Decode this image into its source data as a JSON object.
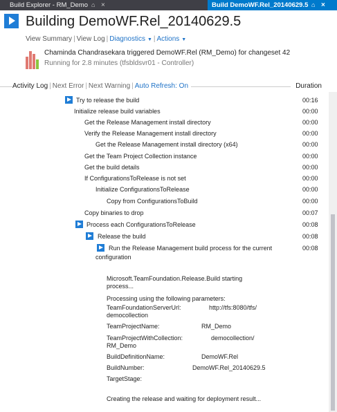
{
  "tabs": [
    {
      "label": "Build Explorer - RM_Demo",
      "pin": "⌂",
      "close": "×"
    },
    {
      "label": "Build DemoWF.Rel_20140629.5",
      "pin": "⌂",
      "close": "×"
    }
  ],
  "header": {
    "title": "Building DemoWF.Rel_20140629.5",
    "view_summary": "View Summary",
    "view_log": "View Log",
    "diagnostics": "Diagnostics",
    "actions": "Actions",
    "trigger_text": "Chaminda Chandrasekara triggered DemoWF.Rel (RM_Demo) for changeset 42",
    "running_text": "Running for 2.8 minutes (tfsbldsvr01 - Controller)",
    "bar_colors": [
      "#e07a72",
      "#e07a72",
      "#e07a72",
      "#8cc63e"
    ],
    "bar_levels": [
      0.7,
      1.0,
      0.85,
      0.55
    ]
  },
  "logbar": {
    "activity_log": "Activity Log",
    "next_error": "Next Error",
    "next_warning": "Next Warning",
    "auto_refresh": "Auto Refresh: On",
    "duration": "Duration"
  },
  "log": [
    {
      "label": "Try to release the build",
      "dur": "00:16",
      "expand": true,
      "level": 0
    },
    {
      "label": "Initialize release build variables",
      "dur": "00:00",
      "expand": false,
      "level": 1
    },
    {
      "label": "Get the Release Management install directory",
      "dur": "00:00",
      "expand": false,
      "level": 2
    },
    {
      "label": "Verify the Release Management install directory",
      "dur": "00:00",
      "expand": false,
      "level": 2
    },
    {
      "label": "Get the Release Management install directory (x64)",
      "dur": "00:00",
      "expand": false,
      "level": 3
    },
    {
      "label": "Get the Team Project Collection instance",
      "dur": "00:00",
      "expand": false,
      "level": 2
    },
    {
      "label": "Get the build details",
      "dur": "00:00",
      "expand": false,
      "level": 2
    },
    {
      "label": "If ConfigurationsToRelease is not set",
      "dur": "00:00",
      "expand": false,
      "level": 2
    },
    {
      "label": "Initialize ConfigurationsToRelease",
      "dur": "00:00",
      "expand": false,
      "level": 3
    },
    {
      "label": "Copy from ConfigurationsToBuild",
      "dur": "00:00",
      "expand": false,
      "level": 4
    },
    {
      "label": "Copy binaries to drop",
      "dur": "00:07",
      "expand": false,
      "level": 2
    },
    {
      "label": "Process each ConfigurationsToRelease",
      "dur": "00:08",
      "expand": true,
      "level": 2
    },
    {
      "label": "Release the build",
      "dur": "00:08",
      "expand": true,
      "level": 3
    },
    {
      "label": "Run the Release Management build process for the current",
      "dur": "00:08",
      "expand": true,
      "level": 4
    }
  ],
  "log_continuation": "configuration",
  "messages": {
    "starting_1": "Microsoft.TeamFoundation.Release.Build starting",
    "starting_2": "process...",
    "processing": "Processing using the following parameters:",
    "params": [
      {
        "name": "TeamFoundationServerUrl:",
        "name2": "democollection",
        "value": "http://tfs:8080/tfs/"
      },
      {
        "name": "TeamProjectName:",
        "name2": "",
        "value": "RM_Demo"
      },
      {
        "name": "TeamProjectWithCollection:",
        "name2": "RM_Demo",
        "value": "democollection/"
      },
      {
        "name": "BuildDefinitionName:",
        "name2": "",
        "value": "DemoWF.Rel"
      },
      {
        "name": "BuildNumber:",
        "name2": "",
        "value": "DemoWF.Rel_20140629.5"
      },
      {
        "name": "TargetStage:",
        "name2": "",
        "value": ""
      }
    ],
    "creating": "Creating the release and waiting for deployment result..."
  }
}
